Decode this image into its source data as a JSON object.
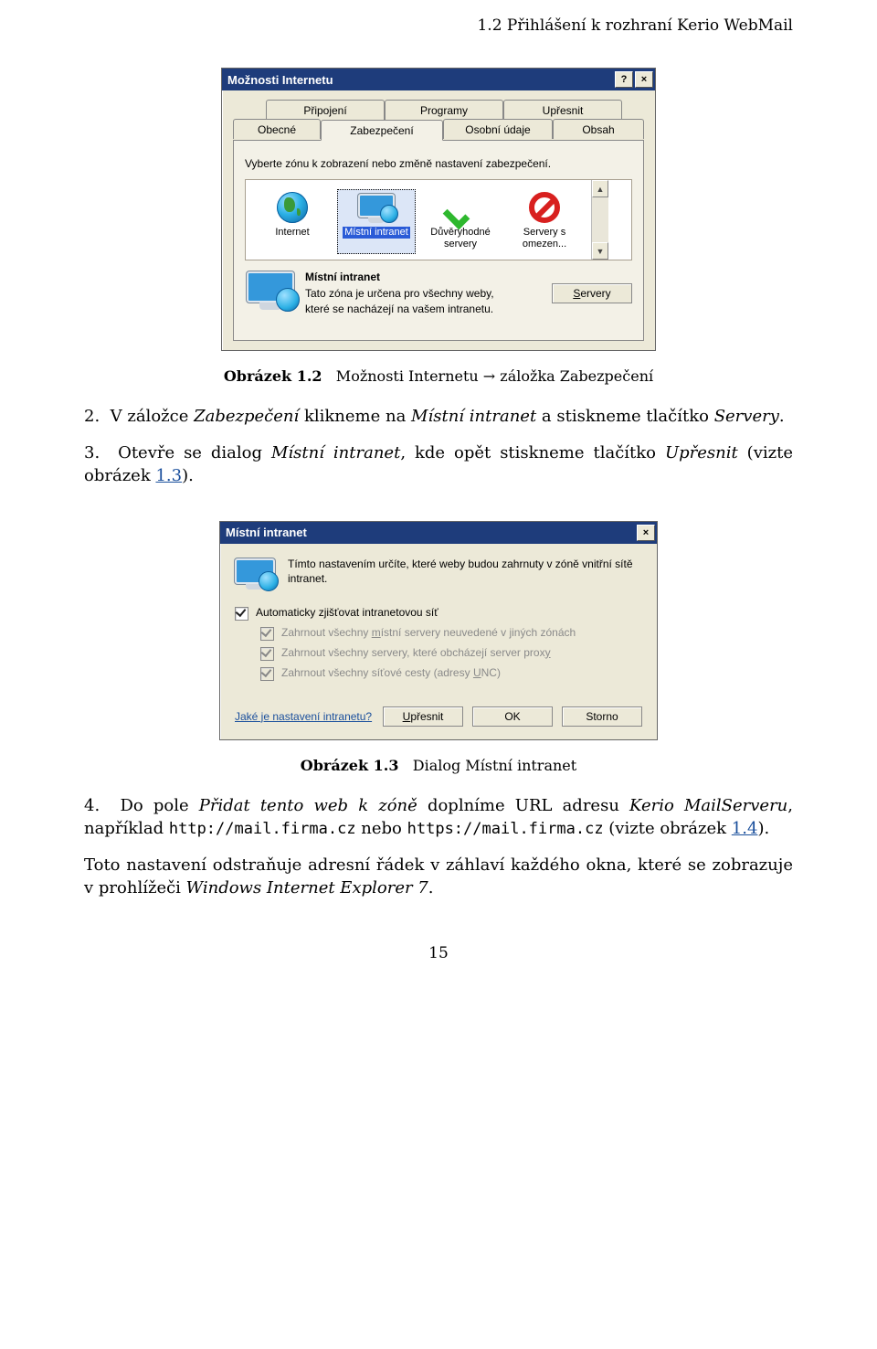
{
  "header": "1.2  Přihlášení k rozhraní Kerio WebMail",
  "caption1": "Obrázek 1.2    Možnosti Internetu → záložka Zabezpečení",
  "step2_a": "V záložce ",
  "step2_b": "Zabezpečení",
  "step2_c": " klikneme na ",
  "step2_d": "Místní intranet",
  "step2_e": " a stiskneme tlačítko ",
  "step2_f": "Servery",
  "step2_g": ".",
  "step3_a": "Otevře se dialog ",
  "step3_b": "Místní intranet",
  "step3_c": ", kde opět stiskneme tlačítko ",
  "step3_d": "Upřesnit",
  "step3_e": " (vizte obrázek ",
  "step3_link": "1.3",
  "step3_f": ").",
  "caption2": "Obrázek 1.3    Dialog Místní intranet",
  "step4_a": "Do pole ",
  "step4_b": "Přidat tento web k zóně",
  "step4_c": " doplníme URL adresu ",
  "step4_d": "Kerio MailServeru",
  "step4_e": ", například ",
  "step4_f": "http://mail.firma.cz",
  "step4_g": " nebo ",
  "step4_h": "https://mail.firma.cz",
  "step4_i": " (vizte obrázek ",
  "step4_link": "1.4",
  "step4_j": ").",
  "footer_a": "Toto nastavení odstraňuje adresní řádek v záhlaví každého okna, které se zobrazuje v prohlížeči ",
  "footer_b": "Windows Internet Explorer 7",
  "footer_c": ".",
  "pagenum": "15",
  "dialog1": {
    "title": "Možnosti Internetu",
    "tabs_top": [
      "Připojení",
      "Programy",
      "Upřesnit"
    ],
    "tabs_bot": [
      "Obecné",
      "Zabezpečení",
      "Osobní údaje",
      "Obsah"
    ],
    "instruction": "Vyberte zónu k zobrazení nebo změně nastavení zabezpečení.",
    "zones": {
      "internet": "Internet",
      "intranet": "Místní intranet",
      "trusted_l1": "Důvěryhodné",
      "trusted_l2": "servery",
      "restrict_l1": "Servery s",
      "restrict_l2": "omezen..."
    },
    "zone_title": "Místní intranet",
    "zone_desc": "Tato zóna je určena pro všechny weby, které se nacházejí na vašem intranetu.",
    "servers_u": "S",
    "servers_rest": "ervery"
  },
  "dialog2": {
    "title": "Místní intranet",
    "intro": "Tímto nastavením určíte, které weby budou zahrnuty v zóně vnitřní sítě intranet.",
    "opt1": "Automaticky zjišťovat intranetovou síť",
    "opt2_a": "Zahrnout všechny ",
    "opt2_u": "m",
    "opt2_b": "ístní servery neuvedené v jiných zónách",
    "opt3_a": "Zahrnout všechny servery, které obcházejí server prox",
    "opt3_u": "y",
    "opt4_a": "Zahrnout všechny síťové cesty (adresy ",
    "opt4_u": "U",
    "opt4_b": "NC)",
    "helplink": "Jaké je nastavení intranetu?",
    "btn1_u": "U",
    "btn1_r": "přesnit",
    "btn2": "OK",
    "btn3": "Storno"
  }
}
